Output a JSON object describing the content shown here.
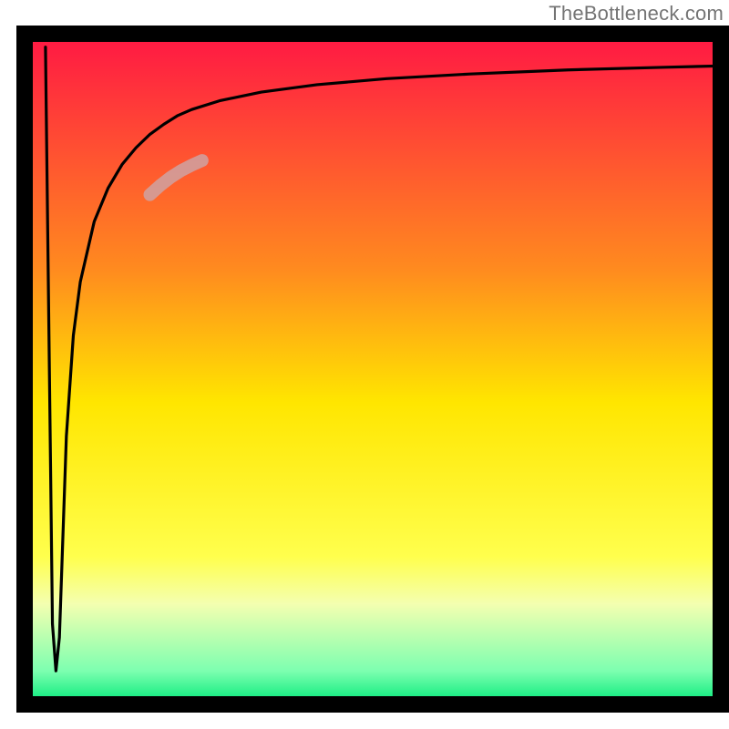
{
  "watermark": "TheBottleneck.com",
  "chart_data": {
    "type": "line",
    "title": "",
    "xlabel": "",
    "ylabel": "",
    "xlim": [
      0,
      100
    ],
    "ylim": [
      0,
      100
    ],
    "grid": false,
    "legend": false,
    "background_gradient_stops": [
      {
        "offset": 0.0,
        "color": "#ff1744"
      },
      {
        "offset": 0.35,
        "color": "#ff8a1f"
      },
      {
        "offset": 0.55,
        "color": "#ffe600"
      },
      {
        "offset": 0.78,
        "color": "#ffff4d"
      },
      {
        "offset": 0.85,
        "color": "#f4ffb0"
      },
      {
        "offset": 0.95,
        "color": "#7dffb0"
      },
      {
        "offset": 1.0,
        "color": "#00e978"
      }
    ],
    "series": [
      {
        "name": "curve",
        "color": "#000000",
        "x": [
          3.0,
          3.5,
          4.0,
          4.5,
          5.0,
          5.5,
          6.0,
          7.0,
          8.0,
          10.0,
          12.0,
          14.0,
          16.0,
          18.0,
          20.0,
          22.0,
          24.0,
          28.0,
          34.0,
          42.0,
          52.0,
          64.0,
          78.0,
          92.0,
          100.0
        ],
        "y": [
          98.0,
          55.0,
          12.0,
          5.0,
          10.0,
          25.0,
          40.0,
          55.0,
          63.0,
          72.0,
          77.0,
          80.5,
          83.0,
          85.0,
          86.5,
          87.8,
          88.7,
          90.0,
          91.3,
          92.4,
          93.3,
          94.0,
          94.6,
          95.0,
          95.2
        ]
      }
    ],
    "highlight_segment": {
      "color": "#cfa2a2",
      "width": 14,
      "x": [
        18.0,
        19.5,
        21.0,
        22.5,
        24.0,
        25.5
      ],
      "y": [
        76.0,
        77.4,
        78.6,
        79.6,
        80.4,
        81.1
      ]
    },
    "frame": {
      "inset_left": 18,
      "inset_right": 0,
      "inset_top": 28,
      "inset_bottom": 18,
      "stroke": "#000000",
      "stroke_width": 18
    }
  }
}
